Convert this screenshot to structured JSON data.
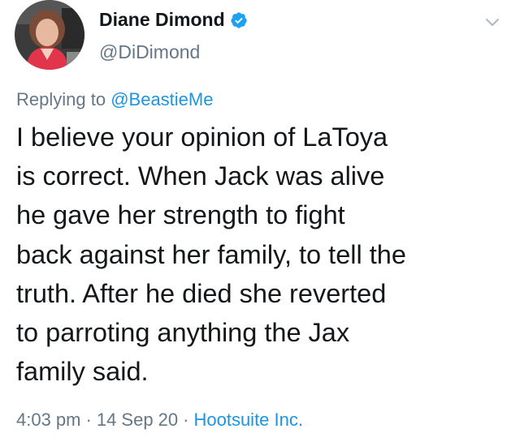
{
  "author": {
    "display_name": "Diane Dimond",
    "handle": "@DiDimond",
    "verified": true
  },
  "reply": {
    "prefix": "Replying to",
    "to_handle": "@BeastieMe"
  },
  "tweet": {
    "lines": [
      "I believe your opinion of LaToya",
      "is correct. When Jack was alive",
      "he gave her strength to fight",
      "back against her family, to tell the",
      "truth. After he died she reverted",
      "to parroting anything the Jax",
      "family said."
    ]
  },
  "meta": {
    "time": "4:03 pm",
    "date": "14 Sep 20",
    "separator": "·",
    "source": "Hootsuite Inc."
  },
  "colors": {
    "link": "#1b95e0",
    "secondary_text": "#657786",
    "primary_text": "#14171a",
    "verified_badge": "#1da1f2"
  },
  "icons": {
    "verified": "verified-badge-icon",
    "menu": "chevron-down-icon"
  }
}
